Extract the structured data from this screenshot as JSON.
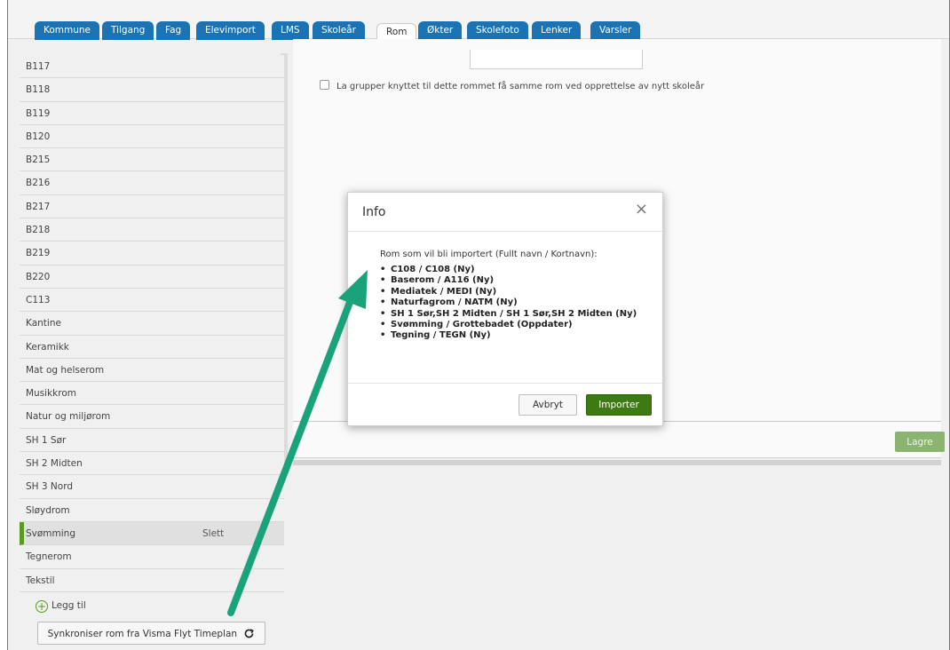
{
  "tabs": [
    {
      "label": "Kommune"
    },
    {
      "label": "Tilgang"
    },
    {
      "label": "Fag"
    },
    {
      "label": "Elevimport"
    },
    {
      "label": "LMS"
    },
    {
      "label": "Skoleår"
    },
    {
      "label": "Rom",
      "active": true
    },
    {
      "label": "Økter"
    },
    {
      "label": "Skolefoto"
    },
    {
      "label": "Lenker"
    },
    {
      "label": "Varsler"
    }
  ],
  "rooms": {
    "items": [
      "B117",
      "B118",
      "B119",
      "B120",
      "B215",
      "B216",
      "B217",
      "B218",
      "B219",
      "B220",
      "C113",
      "Kantine",
      "Keramikk",
      "Mat og helserom",
      "Musikkrom",
      "Natur og miljørom",
      "SH 1 Sør",
      "SH 2 Midten",
      "SH 3 Nord",
      "Sløydrom",
      "Svømming",
      "Tegnerom",
      "Tekstil"
    ],
    "selected": "Svømming",
    "delete_label": "Slett",
    "add_label": "Legg til",
    "sync_label": "Synkroniser rom fra Visma Flyt Timeplan"
  },
  "detail": {
    "checkbox_label": "La grupper knyttet til dette rommet få samme rom ved opprettelse av nytt skoleår",
    "save_label": "Lagre"
  },
  "modal": {
    "title": "Info",
    "close": "×",
    "intro": "Rom som vil bli importert (Fullt navn / Kortnavn):",
    "items": [
      "C108 / C108 (Ny)",
      "Baserom / A116 (Ny)",
      "Mediatek / MEDI (Ny)",
      "Naturfagrom / NATM (Ny)",
      "SH 1 Sør,SH 2 Midten / SH 1 Sør,SH 2 Midten (Ny)",
      "Svømming / Grottebadet (Oppdater)",
      "Tegning / TEGN (Ny)"
    ],
    "cancel_label": "Avbryt",
    "import_label": "Importer"
  },
  "colors": {
    "tab": "#1b73b3",
    "accent_green": "#3d7a12",
    "arrow": "#1aa37a"
  }
}
